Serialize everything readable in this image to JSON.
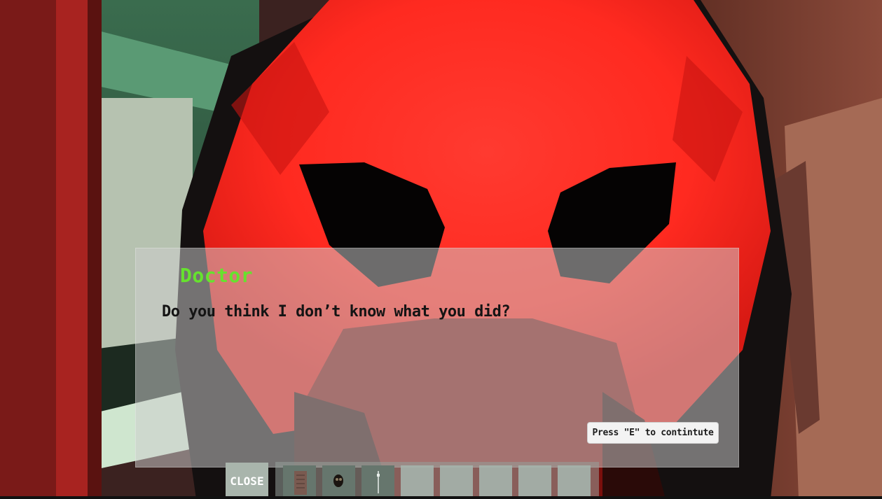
{
  "dialog": {
    "speaker": "Doctor",
    "line": "Do you think I don’t know what you did?",
    "prompt": "Press \"E\" to contintute"
  },
  "hud": {
    "close_label": "CLOSE",
    "inventory": [
      {
        "item": "paper-note-icon"
      },
      {
        "item": "mask-icon"
      },
      {
        "item": "syringe-icon"
      },
      {
        "item": null
      },
      {
        "item": null
      },
      {
        "item": null
      },
      {
        "item": null
      },
      {
        "item": null
      }
    ]
  },
  "colors": {
    "speaker": "#66e22e",
    "mask": "#ff2a20",
    "wall_green": "#4a7d5e"
  }
}
